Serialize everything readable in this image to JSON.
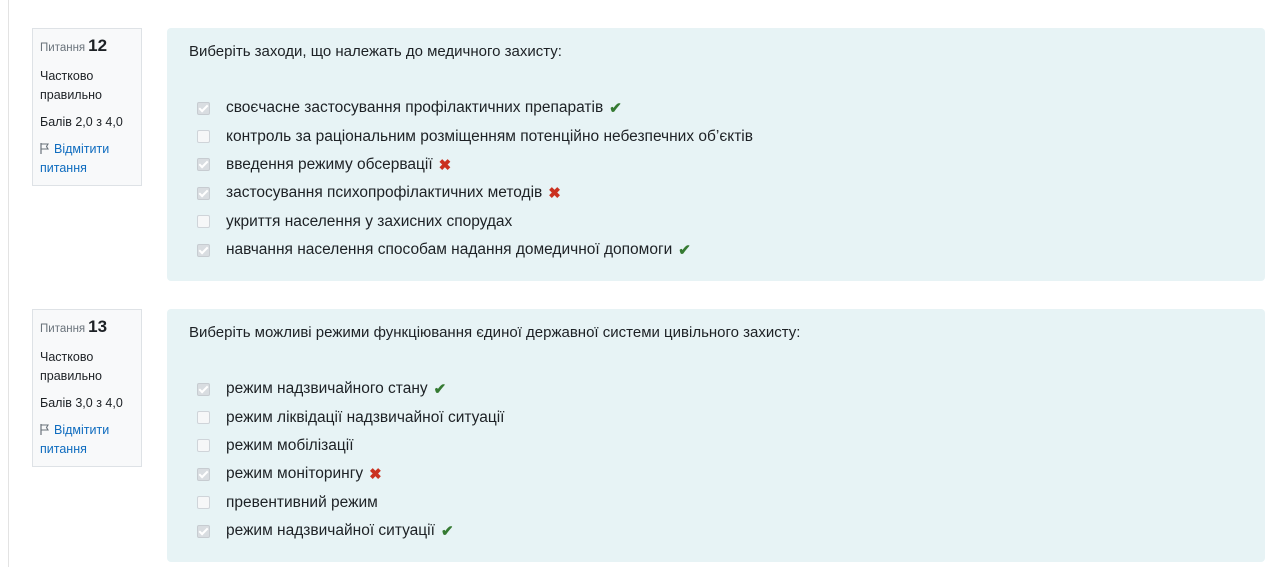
{
  "questions": [
    {
      "label": "Питання",
      "number": "12",
      "state": "Частково правильно",
      "grade": "Балів 2,0 з 4,0",
      "flag_label": "Відмітити питання",
      "text": "Виберіть заходи, що належать до медичного захисту:",
      "answers": [
        {
          "label": "своєчасне застосування профілактичних препаратів",
          "checked": true,
          "mark": "correct"
        },
        {
          "label": "контроль за раціональним розміщенням потенційно небезпечних об’єктів",
          "checked": false,
          "mark": ""
        },
        {
          "label": "введення режиму обсервації",
          "checked": true,
          "mark": "wrong"
        },
        {
          "label": "застосування психопрофілактичних методів",
          "checked": true,
          "mark": "wrong"
        },
        {
          "label": "укриття населення у захисних спорудах",
          "checked": false,
          "mark": ""
        },
        {
          "label": "навчання населення способам надання домедичної допомоги",
          "checked": true,
          "mark": "correct"
        }
      ]
    },
    {
      "label": "Питання",
      "number": "13",
      "state": "Частково правильно",
      "grade": "Балів 3,0 з 4,0",
      "flag_label": "Відмітити питання",
      "text": "Виберіть можливі режими функціювання єдиної державної системи цивільного захисту:",
      "answers": [
        {
          "label": "режим надзвичайного стану",
          "checked": true,
          "mark": "correct"
        },
        {
          "label": "режим ліквідації надзвичайної ситуації",
          "checked": false,
          "mark": ""
        },
        {
          "label": "режим мобілізації",
          "checked": false,
          "mark": ""
        },
        {
          "label": "режим моніторингу",
          "checked": true,
          "mark": "wrong"
        },
        {
          "label": "превентивний режим",
          "checked": false,
          "mark": ""
        },
        {
          "label": "режим надзвичайної ситуації",
          "checked": true,
          "mark": "correct"
        }
      ]
    }
  ],
  "icons": {
    "correct": "check-icon",
    "wrong": "cross-icon",
    "flag": "flag-icon"
  },
  "colors": {
    "correct": "#357a32",
    "wrong": "#ca3120",
    "link": "#0f6cbf",
    "content_bg": "#e7f3f5"
  }
}
